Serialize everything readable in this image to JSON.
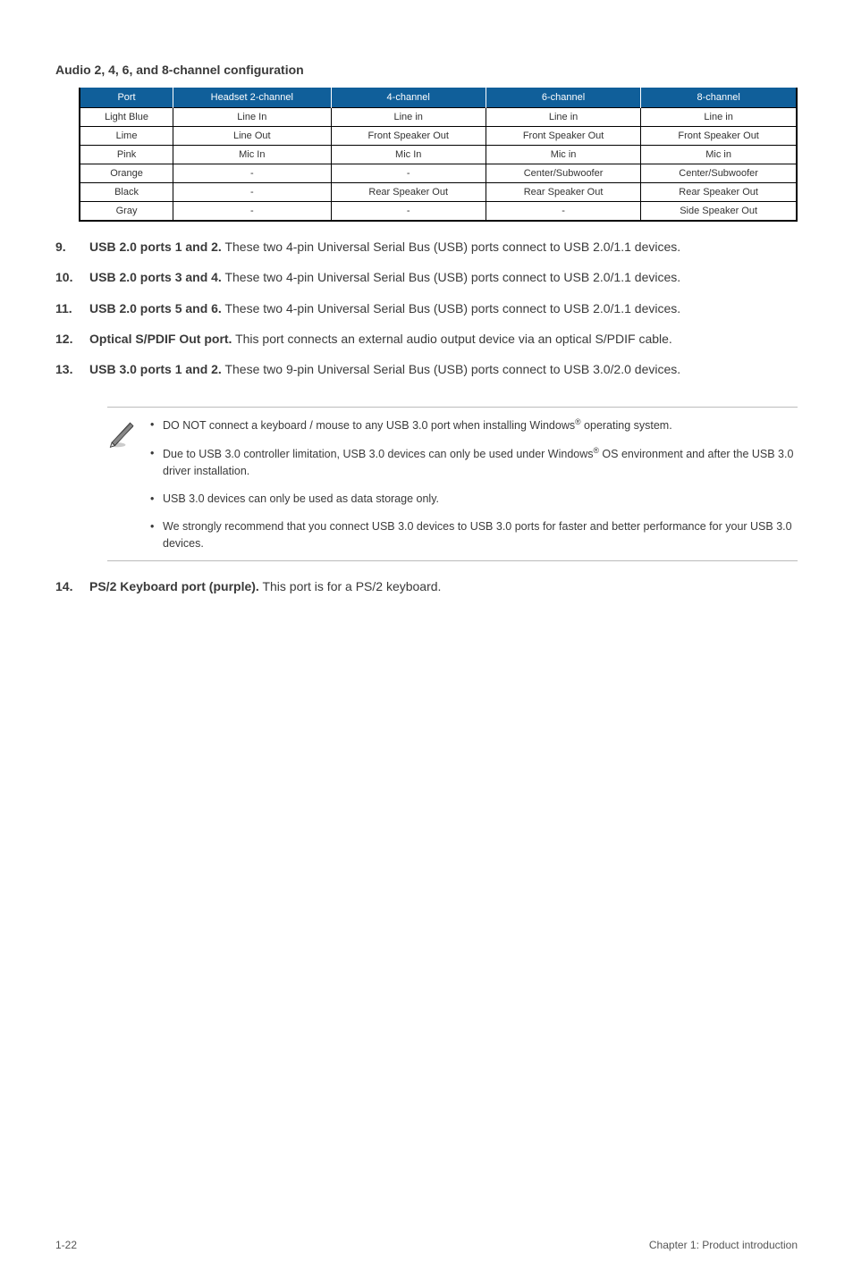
{
  "section_title": "Audio 2, 4, 6, and 8-channel configuration",
  "table": {
    "headers": [
      "Port",
      "Headset 2-channel",
      "4-channel",
      "6-channel",
      "8-channel"
    ],
    "rows": [
      [
        "Light Blue",
        "Line In",
        "Line in",
        "Line in",
        "Line in"
      ],
      [
        "Lime",
        "Line Out",
        "Front Speaker Out",
        "Front Speaker Out",
        "Front Speaker Out"
      ],
      [
        "Pink",
        "Mic In",
        "Mic In",
        "Mic in",
        "Mic in"
      ],
      [
        "Orange",
        "-",
        "-",
        "Center/Subwoofer",
        "Center/Subwoofer"
      ],
      [
        "Black",
        "-",
        "Rear Speaker Out",
        "Rear Speaker Out",
        "Rear Speaker Out"
      ],
      [
        "Gray",
        "-",
        "-",
        "-",
        "Side Speaker Out"
      ]
    ]
  },
  "items": [
    {
      "num": "9.",
      "lead": "USB 2.0 ports 1 and 2.",
      "rest": " These two 4-pin Universal Serial Bus (USB) ports connect to USB 2.0/1.1 devices."
    },
    {
      "num": "10.",
      "lead": "USB 2.0 ports 3 and 4.",
      "rest": " These two 4-pin Universal Serial Bus (USB) ports connect to USB 2.0/1.1 devices."
    },
    {
      "num": "11.",
      "lead": "USB 2.0 ports 5 and 6.",
      "rest": " These two 4-pin Universal Serial Bus (USB) ports connect to USB 2.0/1.1 devices."
    },
    {
      "num": "12.",
      "lead": "Optical S/PDIF Out port.",
      "rest": " This port connects an external audio output device via an optical S/PDIF cable."
    },
    {
      "num": "13.",
      "lead": "USB 3.0 ports 1 and 2.",
      "rest": " These two 9-pin Universal Serial Bus (USB) ports connect to USB 3.0/2.0 devices."
    }
  ],
  "notes": [
    {
      "pre": "DO NOT connect a keyboard / mouse to any USB 3.0 port when installing Windows",
      "sup": "®",
      "post": " operating system."
    },
    {
      "pre": "Due to USB 3.0 controller limitation, USB 3.0 devices can only be used under Windows",
      "sup": "®",
      "post": " OS environment and after the USB 3.0 driver installation."
    },
    {
      "pre": "USB 3.0 devices can only be used as data storage only.",
      "sup": "",
      "post": ""
    },
    {
      "pre": "We strongly recommend that you connect USB 3.0 devices to USB 3.0 ports for faster and better performance for your USB 3.0 devices.",
      "sup": "",
      "post": ""
    }
  ],
  "item14": {
    "num": "14.",
    "lead": "PS/2 Keyboard port (purple).",
    "rest": " This port is for a PS/2 keyboard."
  },
  "footer": {
    "left": "1-22",
    "right": "Chapter 1: Product introduction"
  }
}
